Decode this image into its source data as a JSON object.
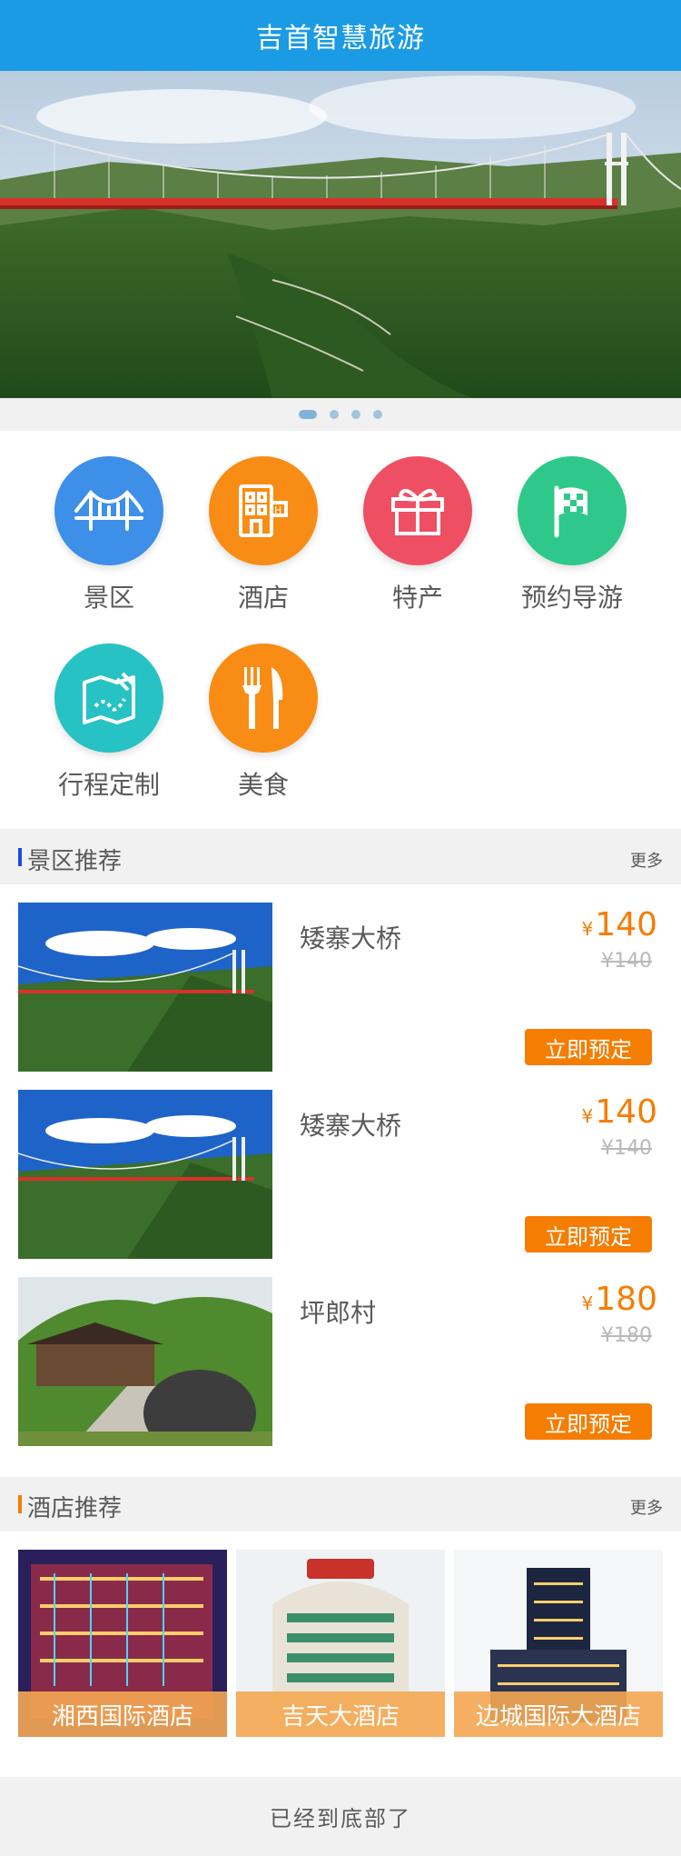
{
  "header": {
    "title": "吉首智慧旅游"
  },
  "banner": {
    "slide_count": 4,
    "active_index": 0
  },
  "categories": [
    {
      "label": "景区",
      "icon": "bridge-icon",
      "color": "#3d8fe8"
    },
    {
      "label": "酒店",
      "icon": "hotel-building-icon",
      "color": "#f98c14"
    },
    {
      "label": "特产",
      "icon": "gift-box-icon",
      "color": "#ef4f63"
    },
    {
      "label": "预约导游",
      "icon": "flag-icon",
      "color": "#2ec98a"
    },
    {
      "label": "行程定制",
      "icon": "map-pen-icon",
      "color": "#27c2c3"
    },
    {
      "label": "美食",
      "icon": "fork-knife-icon",
      "color": "#f98c14"
    }
  ],
  "scenic_section": {
    "title": "景区推荐",
    "more": "更多",
    "accent": "#1b4be4",
    "items": [
      {
        "name": "矮寨大桥",
        "price": "140",
        "old_price": "¥140",
        "button": "立即预定"
      },
      {
        "name": "矮寨大桥",
        "price": "140",
        "old_price": "¥140",
        "button": "立即预定"
      },
      {
        "name": "坪郎村",
        "price": "180",
        "old_price": "¥180",
        "button": "立即预定"
      }
    ]
  },
  "hotel_section": {
    "title": "酒店推荐",
    "more": "更多",
    "accent": "#f57d02",
    "items": [
      {
        "name": "湘西国际酒店"
      },
      {
        "name": "吉天大酒店"
      },
      {
        "name": "边城国际大酒店"
      }
    ]
  },
  "currency_symbol": "¥",
  "footer": {
    "text": "已经到底部了"
  },
  "colors": {
    "header": "#1b9be4",
    "price": "#f57d02",
    "old_price": "#b9b9b9",
    "text": "#5a5a5a"
  }
}
